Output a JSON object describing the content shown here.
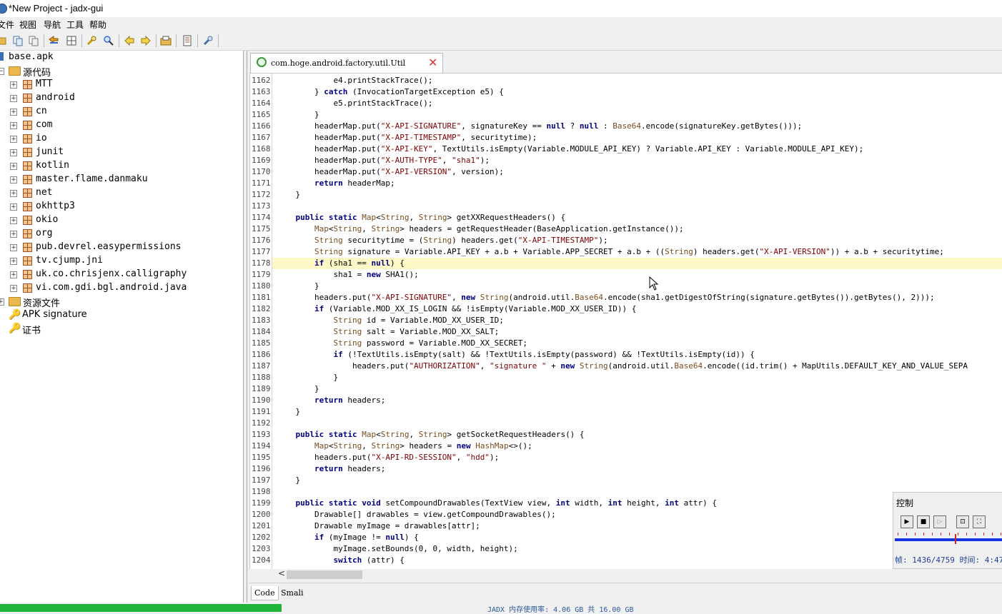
{
  "window": {
    "title": "*New Project - jadx-gui"
  },
  "menu": [
    "文件",
    "视图",
    "导航",
    "工具",
    "帮助"
  ],
  "toolbar_icons": [
    "open-icon",
    "copy-icon",
    "paste-icon",
    "sync-icon",
    "flatten-icon",
    "search-text-icon",
    "search-icon",
    "back-icon",
    "forward-icon",
    "export-icon",
    "log-icon",
    "preferences-icon"
  ],
  "tree": {
    "root": "base.apk",
    "source_label": "源代码",
    "packages": [
      "MTT",
      "android",
      "cn",
      "com",
      "io",
      "junit",
      "kotlin",
      "master.flame.danmaku",
      "net",
      "okhttp3",
      "okio",
      "org",
      "pub.devrel.easypermissions",
      "tv.cjump.jni",
      "uk.co.chrisjenx.calligraphy",
      "vi.com.gdi.bgl.android.java"
    ],
    "resources_label": "资源文件",
    "apk_signature_label": "APK signature",
    "cert_label": "证书"
  },
  "editor": {
    "tab_title": "com.hoge.android.factory.util.Util",
    "highlight_line": "1178",
    "lines": [
      {
        "n": "1162",
        "t": "            e4.printStackTrace();"
      },
      {
        "n": "1163",
        "t": "        } catch (InvocationTargetException e5) {"
      },
      {
        "n": "1164",
        "t": "            e5.printStackTrace();"
      },
      {
        "n": "1165",
        "t": "        }"
      },
      {
        "n": "1166",
        "t": "        headerMap.put(\"X-API-SIGNATURE\", signatureKey == null ? null : Base64.encode(signatureKey.getBytes()));"
      },
      {
        "n": "1167",
        "t": "        headerMap.put(\"X-API-TIMESTAMP\", securitytime);"
      },
      {
        "n": "1168",
        "t": "        headerMap.put(\"X-API-KEY\", TextUtils.isEmpty(Variable.MODULE_API_KEY) ? Variable.API_KEY : Variable.MODULE_API_KEY);"
      },
      {
        "n": "1169",
        "t": "        headerMap.put(\"X-AUTH-TYPE\", \"sha1\");"
      },
      {
        "n": "1170",
        "t": "        headerMap.put(\"X-API-VERSION\", version);"
      },
      {
        "n": "1171",
        "t": "        return headerMap;"
      },
      {
        "n": "1172",
        "t": "    }"
      },
      {
        "n": "1173",
        "t": ""
      },
      {
        "n": "1174",
        "t": "    public static Map<String, String> getXXRequestHeaders() {"
      },
      {
        "n": "1175",
        "t": "        Map<String, String> headers = getRequestHeader(BaseApplication.getInstance());"
      },
      {
        "n": "1176",
        "t": "        String securitytime = (String) headers.get(\"X-API-TIMESTAMP\");"
      },
      {
        "n": "1177",
        "t": "        String signature = Variable.API_KEY + a.b + Variable.APP_SECRET + a.b + ((String) headers.get(\"X-API-VERSION\")) + a.b + securitytime;"
      },
      {
        "n": "1178",
        "t": "        if (sha1 == null) {"
      },
      {
        "n": "1179",
        "t": "            sha1 = new SHA1();"
      },
      {
        "n": "1180",
        "t": "        }"
      },
      {
        "n": "1181",
        "t": "        headers.put(\"X-API-SIGNATURE\", new String(android.util.Base64.encode(sha1.getDigestOfString(signature.getBytes()).getBytes(), 2)));"
      },
      {
        "n": "1182",
        "t": "        if (Variable.MOD_XX_IS_LOGIN && !isEmpty(Variable.MOD_XX_USER_ID)) {"
      },
      {
        "n": "1183",
        "t": "            String id = Variable.MOD_XX_USER_ID;"
      },
      {
        "n": "1184",
        "t": "            String salt = Variable.MOD_XX_SALT;"
      },
      {
        "n": "1185",
        "t": "            String password = Variable.MOD_XX_SECRET;"
      },
      {
        "n": "1186",
        "t": "            if (!TextUtils.isEmpty(salt) && !TextUtils.isEmpty(password) && !TextUtils.isEmpty(id)) {"
      },
      {
        "n": "1187",
        "t": "                headers.put(\"AUTHORIZATION\", \"signature \" + new String(android.util.Base64.encode((id.trim() + MapUtils.DEFAULT_KEY_AND_VALUE_SEPA"
      },
      {
        "n": "1188",
        "t": "            }"
      },
      {
        "n": "1189",
        "t": "        }"
      },
      {
        "n": "1190",
        "t": "        return headers;"
      },
      {
        "n": "1191",
        "t": "    }"
      },
      {
        "n": "1192",
        "t": ""
      },
      {
        "n": "1193",
        "t": "    public static Map<String, String> getSocketRequestHeaders() {"
      },
      {
        "n": "1194",
        "t": "        Map<String, String> headers = new HashMap<>();"
      },
      {
        "n": "1195",
        "t": "        headers.put(\"X-API-RD-SESSION\", \"hdd\");"
      },
      {
        "n": "1196",
        "t": "        return headers;"
      },
      {
        "n": "1197",
        "t": "    }"
      },
      {
        "n": "1198",
        "t": ""
      },
      {
        "n": "1199",
        "t": "    public static void setCompoundDrawables(TextView view, int width, int height, int attr) {"
      },
      {
        "n": "1200",
        "t": "        Drawable[] drawables = view.getCompoundDrawables();"
      },
      {
        "n": "1201",
        "t": "        Drawable myImage = drawables[attr];"
      },
      {
        "n": "1202",
        "t": "        if (myImage != null) {"
      },
      {
        "n": "1203",
        "t": "            myImage.setBounds(0, 0, width, height);"
      },
      {
        "n": "1204",
        "t": "            switch (attr) {"
      }
    ],
    "bottom_tabs": [
      "Code",
      "Smali"
    ],
    "scroll_left_arrow": "<"
  },
  "status": {
    "memory_text": "JADX 内存使用率: 4.06 GB 共 16.00 GB"
  },
  "control_window": {
    "title": "控制",
    "info": "帧: 1436/4759 时间: 4:47",
    "buttons": [
      "play-icon",
      "stop-icon",
      "step-icon",
      "fit-icon",
      "fullscreen-icon"
    ],
    "position_fraction": 0.3
  },
  "colors": {
    "keyword": "#000080",
    "string": "#800000",
    "highlight": "#fdf8c6",
    "memory_bar": "#22b33a"
  }
}
